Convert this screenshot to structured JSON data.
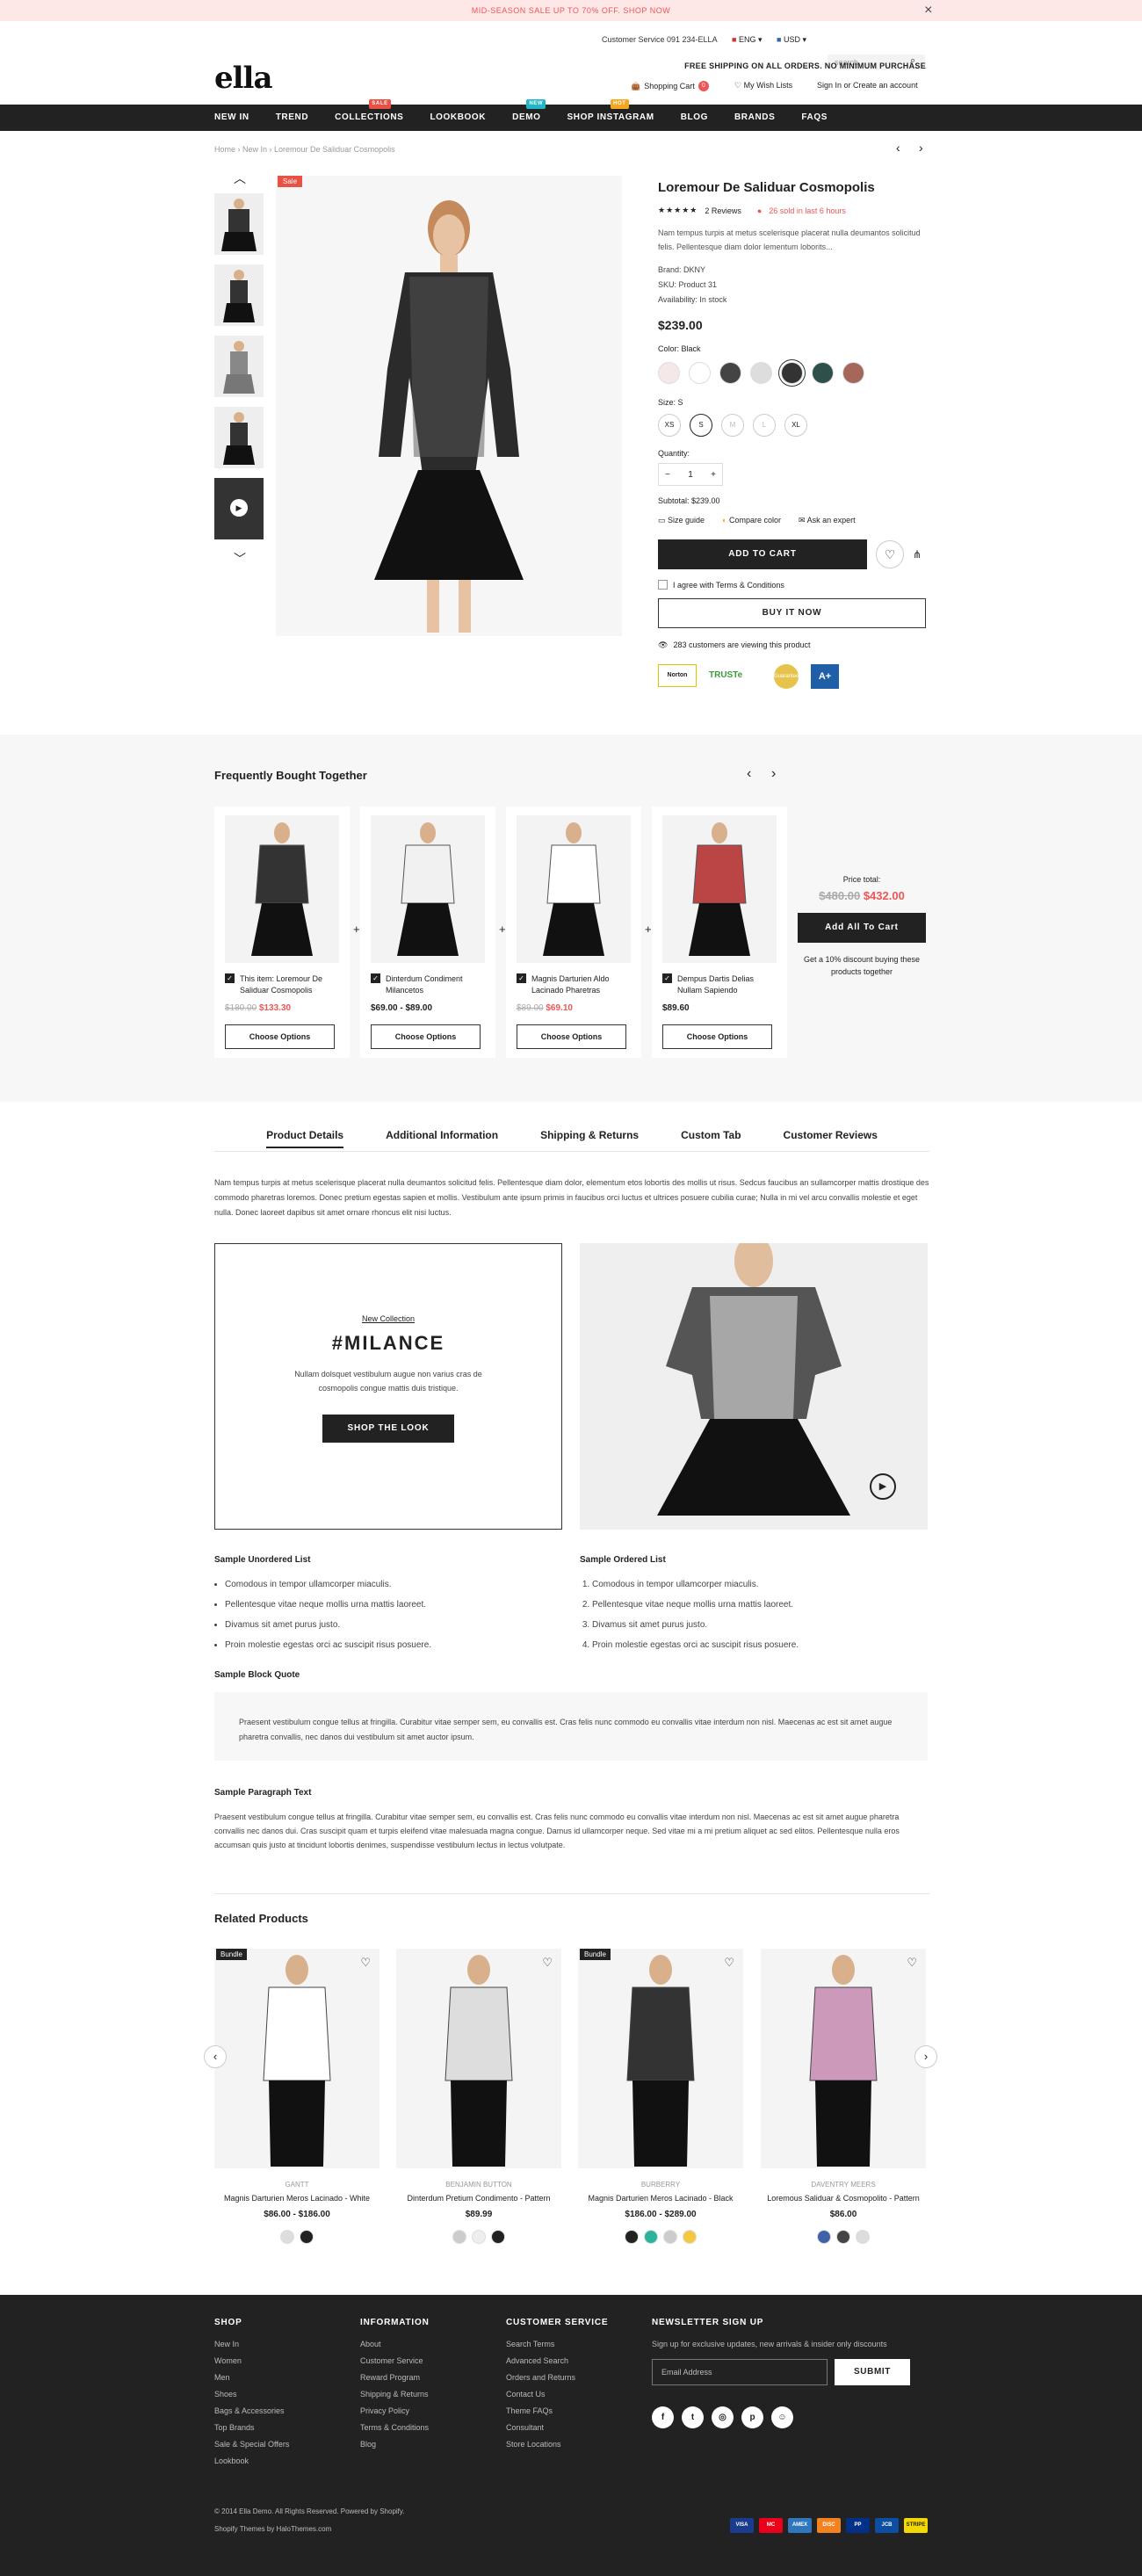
{
  "promo": "MID-SEASON SALE UP TO 70% OFF. SHOP NOW",
  "header": {
    "service": "Customer Service 091 234-ELLA",
    "lang": "ENG",
    "currency": "USD",
    "search_placeholder": "search",
    "shipping": "FREE SHIPPING ON ALL ORDERS. NO MINIMUM PURCHASE",
    "cart": "Shopping Cart",
    "cart_count": "0",
    "wishlist": "My Wish Lists",
    "account": "Sign In or Create an account",
    "logo": "ella"
  },
  "nav": [
    {
      "label": "NEW IN"
    },
    {
      "label": "TREND"
    },
    {
      "label": "COLLECTIONS",
      "badge": "SALE",
      "color": "#e95144"
    },
    {
      "label": "LOOKBOOK"
    },
    {
      "label": "DEMO",
      "badge": "NEW",
      "color": "#1fb7c8"
    },
    {
      "label": "SHOP INSTAGRAM",
      "badge": "HOT",
      "color": "#f5a623"
    },
    {
      "label": "BLOG"
    },
    {
      "label": "BRANDS"
    },
    {
      "label": "FAQS"
    }
  ],
  "breadcrumb": [
    "Home",
    "New In",
    "Loremour De Saliduar Cosmopolis"
  ],
  "product": {
    "sale_badge": "Sale",
    "title": "Loremour De Saliduar Cosmopolis",
    "stars": "★★★★★",
    "reviews": "2 Reviews",
    "sold": "26 sold in last 6 hours",
    "desc": "Nam tempus turpis at metus scelerisque placerat nulla deumantos solicitud felis. Pellentesque diam dolor lementum loborits...",
    "brand": "Brand: DKNY",
    "sku": "SKU: Product 31",
    "availability": "Availability: In stock",
    "price": "$239.00",
    "color_label": "Color: Black",
    "size_label": "Size: S",
    "sizes": [
      "XS",
      "S",
      "M",
      "L",
      "XL"
    ],
    "qty_label": "Quantity:",
    "qty": "1",
    "subtotal": "Subtotal: $239.00",
    "size_guide": "Size guide",
    "compare": "Compare color",
    "ask": "Ask an expert",
    "add_to_cart": "ADD TO CART",
    "agree": "I agree with Terms & Conditions",
    "buy_now": "BUY IT NOW",
    "viewing": "283 customers are viewing this product",
    "trust": [
      "Norton",
      "TRUSTe",
      "Guarantee",
      "A+"
    ]
  },
  "fbt": {
    "title": "Frequently Bought Together",
    "items": [
      {
        "name": "This item: Loremour De Saliduar Cosmopolis",
        "old": "$180.00",
        "price": "$133.30",
        "btn": "Choose Options"
      },
      {
        "name": "Dinterdum Condiment Milancetos",
        "old": "",
        "price": "$69.00 - $89.00",
        "btn": "Choose Options"
      },
      {
        "name": "Magnis Darturien Aldo Lacinado Pharetras",
        "old": "$89.00",
        "price": "$69.10",
        "btn": "Choose Options"
      },
      {
        "name": "Dempus Dartis Delias Nullam Sapiendo",
        "old": "",
        "price": "$89.60",
        "btn": "Choose Options"
      }
    ],
    "price_total_label": "Price total:",
    "old_total": "$480.00",
    "total": "$432.00",
    "add_all": "Add All To Cart",
    "discount": "Get a 10% discount buying these products together"
  },
  "tabs": [
    "Product Details",
    "Additional Information",
    "Shipping & Returns",
    "Custom Tab",
    "Customer Reviews"
  ],
  "details": {
    "intro": "Nam tempus turpis at metus scelerisque placerat nulla deumantos solicitud felis. Pellentesque diam dolor, elementum etos lobortis des mollis ut risus. Sedcus faucibus an sullamcorper mattis drostique des commodo pharetras loremos. Donec pretium egestas sapien et mollis. Vestibulum ante ipsum primis in faucibus orci luctus et ultrices posuere cubilia curae; Nulla in mi vel arcu convallis molestie et eget nulla. Donec laoreet dapibus sit amet ornare rhoncus elit nisi luctus.",
    "new_collection": "New Collection",
    "hashtag": "#MILANCE",
    "promo_text": "Nullam dolsquet vestibulum augue non varius cras de cosmopolis congue mattis duis tristique.",
    "shop_look": "SHOP THE LOOK",
    "ul_title": "Sample Unordered List",
    "ol_title": "Sample Ordered List",
    "list": [
      "Comodous in tempor ullamcorper miaculis.",
      "Pellentesque vitae neque mollis urna mattis laoreet.",
      "Divamus sit amet purus justo.",
      "Proin molestie egestas orci ac suscipit risus posuere."
    ],
    "quote_title": "Sample Block Quote",
    "quote": "Praesent vestibulum congue tellus at fringilla. Curabitur vitae semper sem, eu convallis est. Cras felis nunc commodo eu convallis vitae interdum non nisl. Maecenas ac est sit amet augue pharetra convallis, nec danos dui vestibulum sit amet auctor ipsum.",
    "para_title": "Sample Paragraph Text",
    "para": "Praesent vestibulum congue tellus at fringilla. Curabitur vitae semper sem, eu convallis est. Cras felis nunc commodo eu convallis vitae interdum non nisl. Maecenas ac est sit amet augue pharetra convallis nec danos dui. Cras suscipit quam et turpis eleifend vitae malesuada magna congue. Damus id ullamcorper neque. Sed vitae mi a mi pretium aliquet ac sed elitos. Pellentesque nulla eros accumsan quis justo at tincidunt lobortis denimes, suspendisse vestibulum lectus in lectus volutpate."
  },
  "related": {
    "title": "Related Products",
    "items": [
      {
        "badge": "Bundle",
        "brand": "GANTT",
        "name": "Magnis Darturien Meros Lacinado - White",
        "price": "$86.00 - $186.00"
      },
      {
        "badge": "",
        "brand": "BENJAMIN BUTTON",
        "name": "Dinterdum Pretium Condimento - Pattern",
        "price": "$89.99"
      },
      {
        "badge": "Bundle",
        "brand": "BURBERRY",
        "name": "Magnis Darturien Meros Lacinado - Black",
        "price": "$186.00 - $289.00"
      },
      {
        "badge": "",
        "brand": "DAVENTRY MEERS",
        "name": "Loremous Saliduar & Cosmopolito - Pattern",
        "price": "$86.00"
      }
    ]
  },
  "footer": {
    "shop_title": "SHOP",
    "shop": [
      "New In",
      "Women",
      "Men",
      "Shoes",
      "Bags & Accessories",
      "Top Brands",
      "Sale & Special Offers",
      "Lookbook"
    ],
    "info_title": "INFORMATION",
    "info": [
      "About",
      "Customer Service",
      "Reward Program",
      "Shipping & Returns",
      "Privacy Policy",
      "Terms & Conditions",
      "Blog"
    ],
    "cs_title": "CUSTOMER SERVICE",
    "cs": [
      "Search Terms",
      "Advanced Search",
      "Orders and Returns",
      "Contact Us",
      "Theme FAQs",
      "Consultant",
      "Store Locations"
    ],
    "news_title": "NEWSLETTER SIGN UP",
    "news_text": "Sign up for exclusive updates, new arrivals & insider only discounts",
    "email_placeholder": "Email Address",
    "submit": "SUBMIT",
    "copyright": "© 2014 Ella Demo. All Rights Reserved. Powered by Shopify.",
    "credit": "Shopify Themes by HaloThemes.com",
    "payments": [
      "VISA",
      "MC",
      "AMEX",
      "DISC",
      "PP",
      "JCB",
      "STRIPE"
    ]
  }
}
